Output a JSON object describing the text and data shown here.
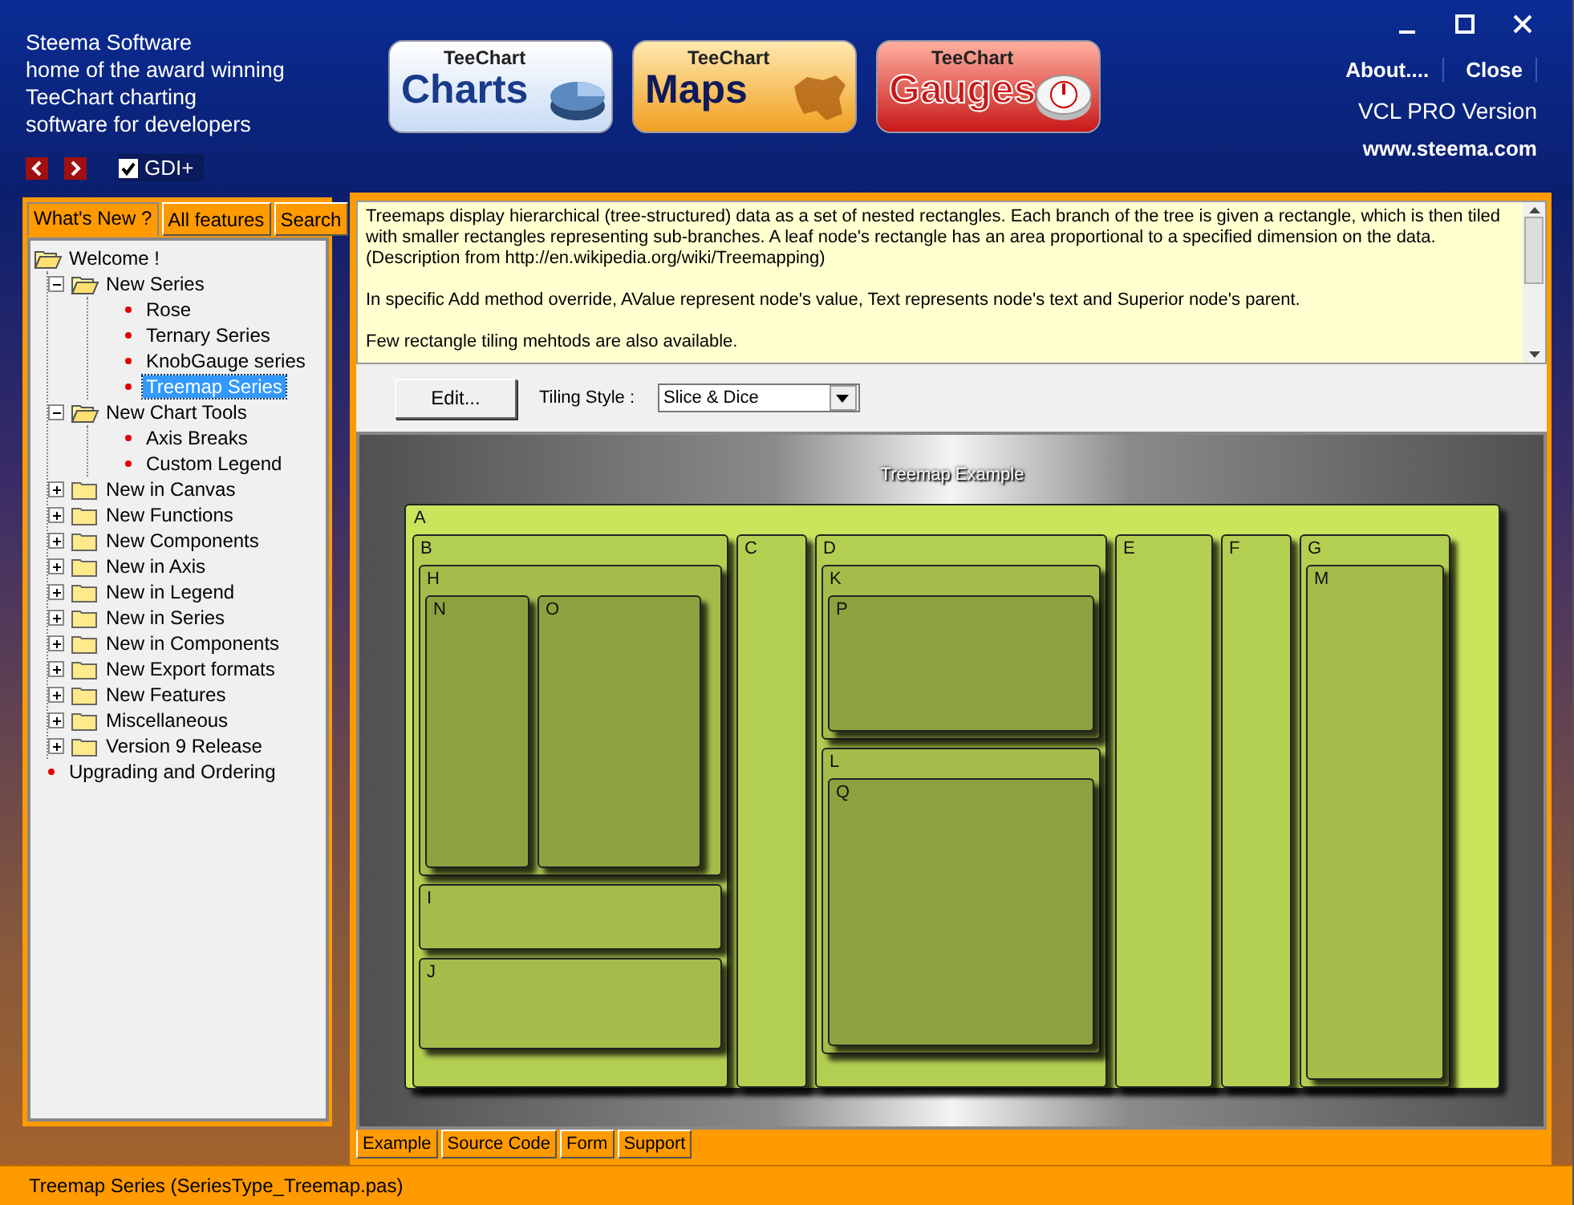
{
  "header": {
    "tagline": [
      "Steema Software",
      "home of the award winning",
      "TeeChart charting",
      "software for developers"
    ],
    "gdi": {
      "label": "GDI+",
      "checked": true
    },
    "products": [
      {
        "brand": "TeeChart",
        "name": "Charts",
        "kind": "charts"
      },
      {
        "brand": "TeeChart",
        "name": "Maps",
        "kind": "maps"
      },
      {
        "brand": "TeeChart",
        "name": "Gauges",
        "kind": "gauges"
      }
    ],
    "links": [
      "About....",
      "Close"
    ],
    "version": "VCL PRO Version",
    "website": "www.steema.com"
  },
  "sidebar": {
    "tabs": [
      {
        "label": "What's New ?",
        "selected": true
      },
      {
        "label": "All features",
        "selected": false
      },
      {
        "label": "Search",
        "selected": false
      }
    ],
    "tree": [
      {
        "label": "Welcome !",
        "kind": "folder",
        "expanded": true,
        "selected": false,
        "children": [
          {
            "label": "New Series",
            "kind": "folder",
            "expanded": true,
            "selected": false,
            "children": [
              {
                "label": "Rose",
                "kind": "topic",
                "selected": false
              },
              {
                "label": "Ternary Series",
                "kind": "topic",
                "selected": false
              },
              {
                "label": "KnobGauge series",
                "kind": "topic",
                "selected": false
              },
              {
                "label": "Treemap Series",
                "kind": "topic",
                "selected": true
              }
            ]
          },
          {
            "label": "New Chart Tools",
            "kind": "folder",
            "expanded": true,
            "selected": false,
            "children": [
              {
                "label": "Axis Breaks",
                "kind": "topic",
                "selected": false
              },
              {
                "label": "Custom Legend",
                "kind": "topic",
                "selected": false
              }
            ]
          },
          {
            "label": "New in Canvas",
            "kind": "folder",
            "expanded": false,
            "selected": false
          },
          {
            "label": "New Functions",
            "kind": "folder",
            "expanded": false,
            "selected": false
          },
          {
            "label": "New Components",
            "kind": "folder",
            "expanded": false,
            "selected": false
          },
          {
            "label": "New in Axis",
            "kind": "folder",
            "expanded": false,
            "selected": false
          },
          {
            "label": "New in Legend",
            "kind": "folder",
            "expanded": false,
            "selected": false
          },
          {
            "label": "New in Series",
            "kind": "folder",
            "expanded": false,
            "selected": false
          },
          {
            "label": "New in Components",
            "kind": "folder",
            "expanded": false,
            "selected": false
          },
          {
            "label": "New Export formats",
            "kind": "folder",
            "expanded": false,
            "selected": false
          },
          {
            "label": "New Features",
            "kind": "folder",
            "expanded": false,
            "selected": false
          },
          {
            "label": "Miscellaneous",
            "kind": "folder",
            "expanded": false,
            "selected": false
          },
          {
            "label": "Version 9 Release",
            "kind": "folder",
            "expanded": false,
            "selected": false
          }
        ]
      },
      {
        "label": "Upgrading and Ordering",
        "kind": "topic",
        "selected": false
      }
    ]
  },
  "description": [
    "Treemaps display hierarchical (tree-structured) data as a set of nested rectangles. Each branch of the tree is given a rectangle, which is then tiled with smaller rectangles representing sub-branches. A leaf node's rectangle has an area proportional to a specified dimension on the data. (Description from http://en.wikipedia.org/wiki/Treemapping)",
    "In specific Add method override, AValue represent node's value, Text represents node's text and Superior node's parent.",
    "Few rectangle tiling mehtods are also available."
  ],
  "toolbar": {
    "edit_button": "Edit...",
    "tiling_label": "Tiling Style :",
    "tiling_value": "Slice & Dice"
  },
  "chart": {
    "title": "Treemap Example",
    "nodes": [
      {
        "label": "A",
        "children": [
          {
            "label": "B",
            "children": [
              {
                "label": "H",
                "children": [
                  {
                    "label": "N"
                  },
                  {
                    "label": "O"
                  }
                ]
              },
              {
                "label": "I"
              },
              {
                "label": "J"
              }
            ]
          },
          {
            "label": "C"
          },
          {
            "label": "D",
            "children": [
              {
                "label": "K",
                "children": [
                  {
                    "label": "P"
                  }
                ]
              },
              {
                "label": "L",
                "children": [
                  {
                    "label": "Q"
                  }
                ]
              }
            ]
          },
          {
            "label": "E"
          },
          {
            "label": "F"
          },
          {
            "label": "G",
            "children": [
              {
                "label": "M"
              }
            ]
          }
        ]
      }
    ]
  },
  "bottom_tabs": [
    {
      "label": "Example",
      "selected": true
    },
    {
      "label": "Source Code",
      "selected": false
    },
    {
      "label": "Form",
      "selected": false
    },
    {
      "label": "Support",
      "selected": false
    }
  ],
  "status_bar": "Treemap Series (SeriesType_Treemap.pas)"
}
